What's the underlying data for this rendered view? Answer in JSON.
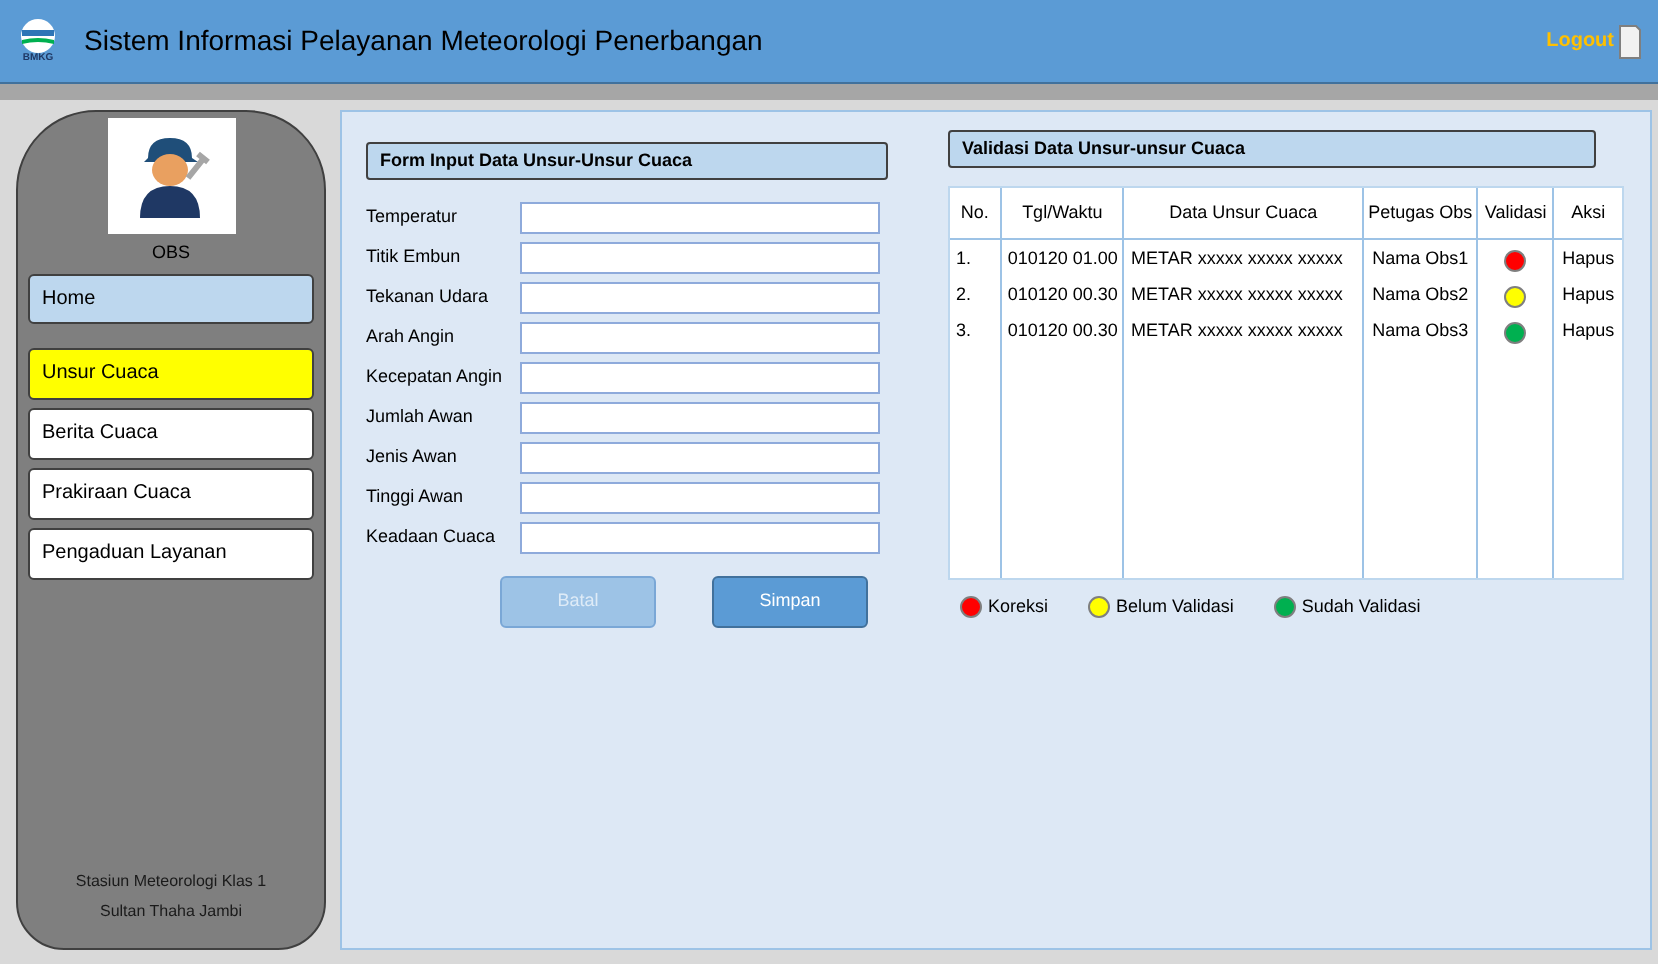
{
  "header": {
    "logo_text": "BMKG",
    "title": "Sistem Informasi Pelayanan Meteorologi Penerbangan",
    "logout": "Logout"
  },
  "sidebar": {
    "user": "OBS",
    "home": "Home",
    "items": [
      {
        "label": "Unsur Cuaca",
        "selected": true
      },
      {
        "label": "Berita Cuaca",
        "selected": false
      },
      {
        "label": "Prakiraan Cuaca",
        "selected": false
      },
      {
        "label": "Pengaduan Layanan",
        "selected": false
      }
    ],
    "footer": [
      "Stasiun Meteorologi Klas 1",
      "Sultan Thaha Jambi"
    ]
  },
  "form": {
    "title": "Form Input Data Unsur-Unsur Cuaca",
    "fields": [
      "Temperatur",
      "Titik Embun",
      "Tekanan Udara",
      "Arah Angin",
      "Kecepatan Angin",
      "Jumlah Awan",
      "Jenis Awan",
      "Tinggi Awan",
      "Keadaan Cuaca"
    ],
    "buttons": [
      {
        "label": "Batal",
        "disabled": true
      },
      {
        "label": "Simpan",
        "disabled": false
      }
    ]
  },
  "validation": {
    "title": "Validasi Data Unsur-unsur Cuaca",
    "columns": [
      "No.",
      "Tgl/Waktu",
      "Data Unsur Cuaca",
      "Petugas Obs",
      "Validasi",
      "Aksi"
    ],
    "rows": [
      {
        "no": "1.",
        "time": "010120 01.00",
        "data": "METAR xxxxx xxxxx xxxxx",
        "officer": "Nama Obs1",
        "color": "#ff0000",
        "action": "Hapus"
      },
      {
        "no": "2.",
        "time": "010120 00.30",
        "data": "METAR xxxxx xxxxx xxxxx",
        "officer": "Nama Obs2",
        "color": "#ffff00",
        "action": "Hapus"
      },
      {
        "no": "3.",
        "time": "010120 00.30",
        "data": "METAR xxxxx xxxxx xxxxx",
        "officer": "Nama Obs3",
        "color": "#00b050",
        "action": "Hapus"
      }
    ],
    "legend": [
      {
        "label": "Koreksi",
        "color": "#ff0000"
      },
      {
        "label": "Belum Validasi",
        "color": "#ffff00"
      },
      {
        "label": "Sudah Validasi",
        "color": "#00b050"
      }
    ]
  }
}
